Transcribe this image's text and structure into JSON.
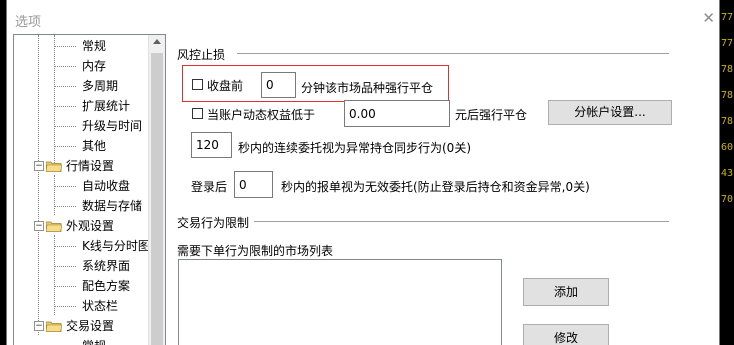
{
  "window": {
    "title": "选项",
    "close_glyph": "✕"
  },
  "tree": {
    "items": [
      {
        "label": "常规",
        "level": 2
      },
      {
        "label": "内存",
        "level": 2
      },
      {
        "label": "多周期",
        "level": 2
      },
      {
        "label": "扩展统计",
        "level": 2
      },
      {
        "label": "升级与时间",
        "level": 2
      },
      {
        "label": "其他",
        "level": 2
      },
      {
        "label": "行情设置",
        "level": 1
      },
      {
        "label": "自动收盘",
        "level": 2
      },
      {
        "label": "数据与存储",
        "level": 2
      },
      {
        "label": "外观设置",
        "level": 1
      },
      {
        "label": "K线与分时图",
        "level": 2
      },
      {
        "label": "系统界面",
        "level": 2
      },
      {
        "label": "配色方案",
        "level": 2
      },
      {
        "label": "状态栏",
        "level": 2
      },
      {
        "label": "交易设置",
        "level": 1
      },
      {
        "label": "常规",
        "level": 2
      }
    ]
  },
  "risk_group": {
    "title": "风控止损",
    "close_before": {
      "label": "收盘前",
      "checked": false,
      "minutes": "0",
      "suffix": "分钟该市场品种强行平仓"
    },
    "equity": {
      "label": "当账户动态权益低于",
      "checked": false,
      "value": "0.00",
      "suffix": "元后强行平仓",
      "button": "分帐户设置..."
    },
    "consecutive": {
      "value": "120",
      "text": "秒内的连续委托视为异常持仓同步行为(0关)"
    },
    "login": {
      "prefix": "登录后",
      "value": "0",
      "text": "秒内的报单视为无效委托(防止登录后持仓和资金异常,0关)"
    }
  },
  "trade_group": {
    "title": "交易行为限制",
    "list_label": "需要下单行为限制的市场列表",
    "add_button": "添加",
    "edit_button": "修改"
  },
  "background_numbers": [
    "77",
    "77",
    "78",
    "78",
    "78",
    "60",
    "43",
    "70"
  ],
  "colors": {
    "highlight_border": "#e03030",
    "button_bg": "#e1e1e1",
    "folder": "#e8c96a"
  }
}
